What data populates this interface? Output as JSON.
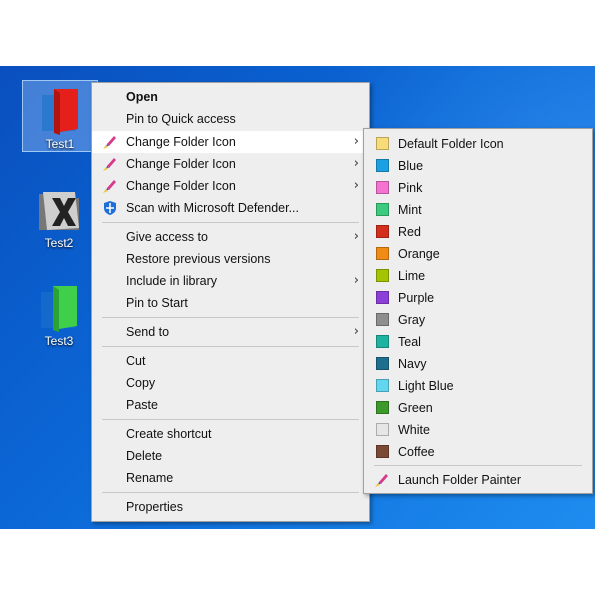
{
  "desktop": {
    "icons": [
      {
        "label": "Test1",
        "color": "#e5201a"
      },
      {
        "label": "Test2",
        "color": "#555555"
      },
      {
        "label": "Test3",
        "color": "#3fcf4a"
      }
    ]
  },
  "context_menu": {
    "items": [
      {
        "label": "Open"
      },
      {
        "label": "Pin to Quick access"
      },
      {
        "label": "Change Folder Icon",
        "icon": "folder-painter-icon"
      },
      {
        "label": "Change Folder Icon",
        "icon": "folder-painter-icon"
      },
      {
        "label": "Change Folder Icon",
        "icon": "folder-painter-icon"
      },
      {
        "label": "Scan with Microsoft Defender...",
        "icon": "defender-shield-icon"
      },
      {
        "label": "Give access to"
      },
      {
        "label": "Restore previous versions"
      },
      {
        "label": "Include in library"
      },
      {
        "label": "Pin to Start"
      },
      {
        "label": "Send to"
      },
      {
        "label": "Cut"
      },
      {
        "label": "Copy"
      },
      {
        "label": "Paste"
      },
      {
        "label": "Create shortcut"
      },
      {
        "label": "Delete"
      },
      {
        "label": "Rename"
      },
      {
        "label": "Properties"
      }
    ]
  },
  "submenu": {
    "items": [
      {
        "label": "Default Folder Icon",
        "color": "#f9dc7a"
      },
      {
        "label": "Blue",
        "color": "#1ba1e2"
      },
      {
        "label": "Pink",
        "color": "#f472d0"
      },
      {
        "label": "Mint",
        "color": "#3ccb7e"
      },
      {
        "label": "Red",
        "color": "#d32f1c"
      },
      {
        "label": "Orange",
        "color": "#f08c15"
      },
      {
        "label": "Lime",
        "color": "#a4c400"
      },
      {
        "label": "Purple",
        "color": "#8c3fd8"
      },
      {
        "label": "Gray",
        "color": "#8e8e8e"
      },
      {
        "label": "Teal",
        "color": "#1eb3a0"
      },
      {
        "label": "Navy",
        "color": "#1e6e8e"
      },
      {
        "label": "Light Blue",
        "color": "#62d6ee"
      },
      {
        "label": "Green",
        "color": "#3c9a2a"
      },
      {
        "label": "White",
        "color": "#e6e6e6"
      },
      {
        "label": "Coffee",
        "color": "#7a4a34"
      }
    ],
    "launch_label": "Launch Folder Painter"
  }
}
